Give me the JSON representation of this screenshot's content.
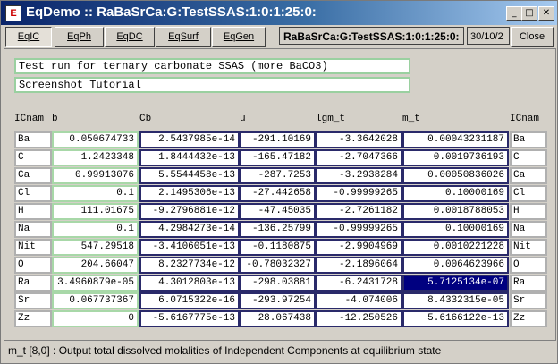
{
  "window": {
    "title": "EqDemo :: RaBaSrCa:G:TestSSAS:1:0:1:25:0:",
    "app_icon": "E",
    "minimize_icon": "0",
    "maximize_icon": "1",
    "close_icon": "x"
  },
  "toolbar": {
    "tabs": [
      {
        "label": "EqIC",
        "active": true
      },
      {
        "label": "EqPh",
        "active": false
      },
      {
        "label": "EqDC",
        "active": false
      },
      {
        "label": "EqSurf",
        "active": false
      },
      {
        "label": "EqGen",
        "active": false
      }
    ],
    "system_name": "RaBaSrCa:G:TestSSAS:1:0:1:25:0:",
    "date": "30/10/2",
    "close_label": "Close"
  },
  "comment": "Test run for ternary carbonate SSAS (more BaCO3)",
  "note": "Screenshot Tutorial",
  "table": {
    "headers": [
      "ICnam",
      "b",
      "Cb",
      "u",
      "lgm_t",
      "m_t",
      "ICnam"
    ],
    "rows": [
      {
        "name": "Ba",
        "b": "0.050674733",
        "cb": "2.5437985e-14",
        "u": "-291.10169",
        "lgm_t": "-3.3642028",
        "m_t": "0.00043231187"
      },
      {
        "name": "C",
        "b": "1.2423348",
        "cb": "1.8444432e-13",
        "u": "-165.47182",
        "lgm_t": "-2.7047366",
        "m_t": "0.0019736193"
      },
      {
        "name": "Ca",
        "b": "0.99913076",
        "cb": "5.5544458e-13",
        "u": "-287.7253",
        "lgm_t": "-3.2938284",
        "m_t": "0.00050836026"
      },
      {
        "name": "Cl",
        "b": "0.1",
        "cb": "2.1495306e-13",
        "u": "-27.442658",
        "lgm_t": "-0.99999265",
        "m_t": "0.10000169"
      },
      {
        "name": "H",
        "b": "111.01675",
        "cb": "-9.2796881e-12",
        "u": "-47.45035",
        "lgm_t": "-2.7261182",
        "m_t": "0.0018788053"
      },
      {
        "name": "Na",
        "b": "0.1",
        "cb": "4.2984273e-14",
        "u": "-136.25799",
        "lgm_t": "-0.99999265",
        "m_t": "0.10000169"
      },
      {
        "name": "Nit",
        "b": "547.29518",
        "cb": "-3.4106051e-13",
        "u": "-0.1180875",
        "lgm_t": "-2.9904969",
        "m_t": "0.0010221228"
      },
      {
        "name": "O",
        "b": "204.66047",
        "cb": "8.2327734e-12",
        "u": "-0.78032327",
        "lgm_t": "-2.1896064",
        "m_t": "0.0064623966"
      },
      {
        "name": "Ra",
        "b": "3.4960879e-05",
        "cb": "4.3012803e-13",
        "u": "-298.03881",
        "lgm_t": "-6.2431728",
        "m_t": "5.7125134e-07"
      },
      {
        "name": "Sr",
        "b": "0.067737367",
        "cb": "6.0715322e-16",
        "u": "-293.97254",
        "lgm_t": "-4.074006",
        "m_t": "8.4332315e-05"
      },
      {
        "name": "Zz",
        "b": "0",
        "cb": "-5.6167775e-13",
        "u": "28.067438",
        "lgm_t": "-12.250526",
        "m_t": "5.6166122e-13"
      }
    ],
    "selected_cell": {
      "row": 8,
      "column": "m_t"
    }
  },
  "status": "m_t [8,0] : Output total dissolved molalities of Independent Components at equilibrium state",
  "colors": {
    "titlebar_start": "#0a246a",
    "titlebar_end": "#a6caf0",
    "editable_border": "#a8d8a8",
    "output_border": "#2a2a6a",
    "selection": "#000080",
    "face": "#d4d0c8"
  }
}
